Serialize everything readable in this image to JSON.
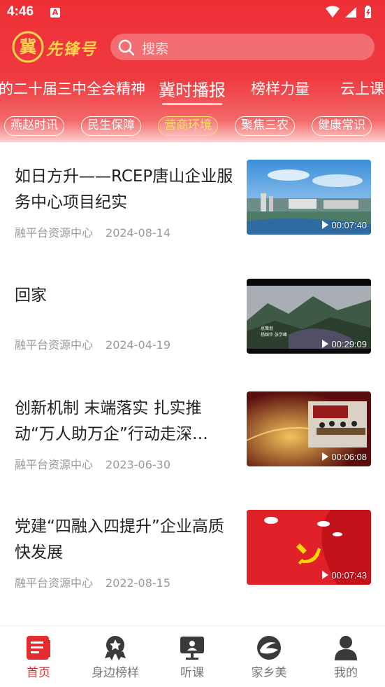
{
  "status_bar": {
    "time": "4:46",
    "notif_icon": "a-letter-icon"
  },
  "header": {
    "logo_text": "先锋号",
    "logo_char": "冀",
    "search": {
      "placeholder": "搜索"
    }
  },
  "tabs": [
    {
      "label": "的二十届三中全会精神",
      "active": false
    },
    {
      "label": "冀时播报",
      "active": true
    },
    {
      "label": "榜样力量",
      "active": false
    },
    {
      "label": "云上课",
      "active": false
    }
  ],
  "chips": [
    {
      "label": "燕赵时讯",
      "active": false
    },
    {
      "label": "民生保障",
      "active": false
    },
    {
      "label": "营商环境",
      "active": true
    },
    {
      "label": "聚焦三农",
      "active": false
    },
    {
      "label": "健康常识",
      "active": false
    }
  ],
  "articles": [
    {
      "title": "如日方升——RCEP唐山企业服务中心项目纪实",
      "source": "融平台资源中心",
      "date": "2024-08-14",
      "duration": "00:07:40",
      "thumb": "city-aerial"
    },
    {
      "title": "回家",
      "source": "融平台资源中心",
      "date": "2024-04-19",
      "duration": "00:29:09",
      "thumb": "mountain-landscape",
      "thumb_caption_1": "总策划",
      "thumb_caption_2": "杨韶华 张学峰"
    },
    {
      "title": "创新机制 末端落实 扎实推动“万人助万企”行动走深…",
      "source": "融平台资源中心",
      "date": "2023-06-30",
      "duration": "00:06:08",
      "thumb": "meeting-room"
    },
    {
      "title": "党建“四融入四提升”企业高质快发展",
      "source": "融平台资源中心",
      "date": "2022-08-15",
      "duration": "00:07:43",
      "thumb": "party-flag"
    }
  ],
  "bottom_nav": [
    {
      "label": "首页",
      "icon": "home-list-icon",
      "active": true
    },
    {
      "label": "身边榜样",
      "icon": "badge-star-icon",
      "active": false
    },
    {
      "label": "听课",
      "icon": "lecture-screen-icon",
      "active": false
    },
    {
      "label": "家乡美",
      "icon": "hometown-swirl-icon",
      "active": false
    },
    {
      "label": "我的",
      "icon": "user-icon",
      "active": false
    }
  ],
  "colors": {
    "brand_red": "#ee2f36",
    "accent_gold": "#ffd34d",
    "nav_active": "#e42c2f"
  }
}
